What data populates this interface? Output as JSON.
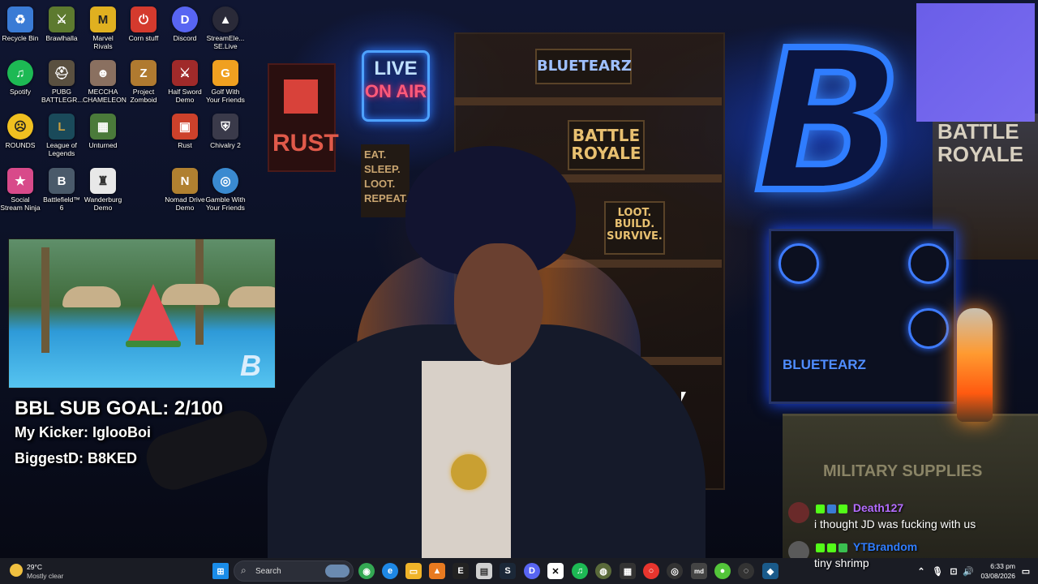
{
  "desktop": {
    "icons": [
      {
        "label": "Recycle Bin",
        "icon": "recycle-bin-icon",
        "color": "#3a7bd5",
        "glyph": "♻"
      },
      {
        "label": "Brawlhalla",
        "icon": "brawlhalla-icon",
        "color": "#5d7a2f",
        "glyph": "⚔"
      },
      {
        "label": "Marvel Rivals",
        "icon": "marvel-rivals-icon",
        "color": "#e0b020",
        "glyph": "M"
      },
      {
        "label": "Corn stuff",
        "icon": "corn-stuff-icon",
        "color": "#d43a2e",
        "glyph": "⏻"
      },
      {
        "label": "Discord",
        "icon": "discord-icon",
        "color": "#5865f2",
        "glyph": "D"
      },
      {
        "label": "StreamEle... SE.Live",
        "icon": "streamelements-icon",
        "color": "#2a2a38",
        "glyph": "▲"
      },
      {
        "label": "Spotify",
        "icon": "spotify-icon",
        "color": "#1db954",
        "glyph": "♫"
      },
      {
        "label": "PUBG BATTLEGR...",
        "icon": "pubg-icon",
        "color": "#5a5040",
        "glyph": "⛑"
      },
      {
        "label": "MECCHA CHAMELEON",
        "icon": "meccha-chameleon-icon",
        "color": "#8a7060",
        "glyph": "☻"
      },
      {
        "label": "Project Zomboid",
        "icon": "project-zomboid-icon",
        "color": "#b07a30",
        "glyph": "Z"
      },
      {
        "label": "Half Sword Demo",
        "icon": "half-sword-icon",
        "color": "#a02a2a",
        "glyph": "⚔"
      },
      {
        "label": "Golf With Your Friends",
        "icon": "golf-icon",
        "color": "#f0a020",
        "glyph": "G"
      },
      {
        "label": "ROUNDS",
        "icon": "rounds-icon",
        "color": "#f0c020",
        "glyph": "☹"
      },
      {
        "label": "League of Legends",
        "icon": "league-of-legends-icon",
        "color": "#1a4a5a",
        "glyph": "L"
      },
      {
        "label": "Unturned",
        "icon": "unturned-icon",
        "color": "#4a7a3a",
        "glyph": "▦"
      },
      {
        "label": "Rust",
        "icon": "rust-icon",
        "color": "#cd412b",
        "glyph": "▣"
      },
      {
        "label": "Chivalry 2",
        "icon": "chivalry-icon",
        "color": "#3a3a4a",
        "glyph": "⛨"
      },
      {
        "label": "Social Stream Ninja",
        "icon": "social-stream-icon",
        "color": "#d84a8a",
        "glyph": "★"
      },
      {
        "label": "Battlefield™ 6",
        "icon": "battlefield-icon",
        "color": "#4a5a6a",
        "glyph": "B"
      },
      {
        "label": "Wanderburg Demo",
        "icon": "wanderburg-icon",
        "color": "#e8e8e8",
        "glyph": "♜"
      },
      {
        "label": "Nomad Drive Demo",
        "icon": "nomad-drive-icon",
        "color": "#b08030",
        "glyph": "N"
      },
      {
        "label": "Gamble With Your Friends",
        "icon": "gamble-icon",
        "color": "#3a8ad0",
        "glyph": "◎"
      }
    ]
  },
  "overlay": {
    "sub_goal": "BBL SUB GOAL: 2/100",
    "kicker": "My Kicker: IglooBoi",
    "biggest": "BiggestD: B8KED"
  },
  "wallpaper": {
    "live_line1": "LIVE",
    "live_line2": "ON AIR",
    "brand": "BLUETEARZ",
    "battle_royale": "BATTLE ROYALE",
    "loot_build": "LOOT. BUILD. SURVIVE.",
    "eat_sleep": "EAT. SLEEP. LOOT. REPEAT.",
    "rust": "RUST",
    "pc_label": "BLUETEARZ",
    "poster": "BATTLE ROYALE",
    "crate": "MILITARY SUPPLIES",
    "big_letter": "B"
  },
  "chat": [
    {
      "user": "Death127",
      "user_color": "#b46cff",
      "message": "i thought JD was fucking with us"
    },
    {
      "user": "YTBrandom",
      "user_color": "#2f7dff",
      "message": "tiny shrimp"
    }
  ],
  "taskbar": {
    "weather_temp": "29°C",
    "weather_desc": "Mostly clear",
    "search_placeholder": "Search",
    "time": "6:33 pm",
    "date": "03/08/2026"
  }
}
